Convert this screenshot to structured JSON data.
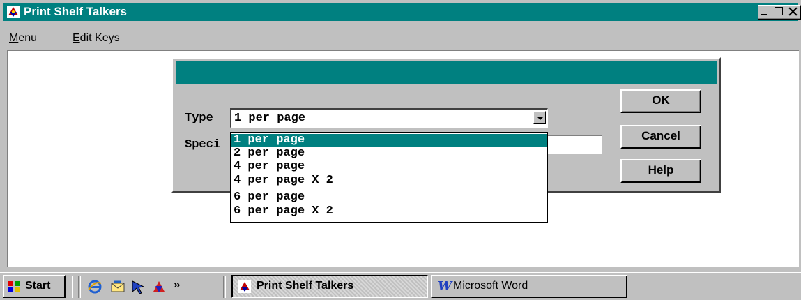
{
  "window": {
    "title": "Print Shelf Talkers",
    "app_icon": "shelf-talkers-icon",
    "controls": [
      "minimize",
      "maximize",
      "close"
    ]
  },
  "menubar": {
    "items": [
      {
        "label": "Menu",
        "underline": "M"
      },
      {
        "label": "Edit Keys",
        "underline": "E"
      }
    ]
  },
  "dialog": {
    "type_label": "Type",
    "type_value": "1 per page",
    "spec_label": "Speci",
    "options": [
      "1 per page",
      "2 per page",
      "4 per page",
      "4 per page X 2",
      "6 per page",
      "6 per page X 2"
    ],
    "selected_index": 0,
    "buttons": {
      "ok": "OK",
      "cancel": "Cancel",
      "help": "Help"
    }
  },
  "taskbar": {
    "start_label": "Start",
    "quick_launch": [
      "internet-explorer-icon",
      "outlook-icon",
      "pointer-icon",
      "shelf-icon"
    ],
    "overflow": "»",
    "tasks": [
      {
        "label": "Print Shelf Talkers",
        "active": true
      },
      {
        "label": "Microsoft Word",
        "active": false
      }
    ]
  },
  "colors": {
    "titlebar": "#008080",
    "face": "#c0c0c0",
    "selection": "#008080"
  }
}
